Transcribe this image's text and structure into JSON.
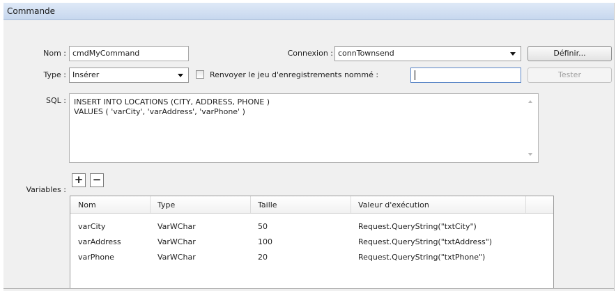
{
  "dialog": {
    "title": "Commande"
  },
  "form": {
    "name_label": "Nom :",
    "name_value": "cmdMyCommand",
    "connection_label": "Connexion :",
    "connection_value": "connTownsend",
    "define_button": "Définir...",
    "type_label": "Type :",
    "type_value": "Insérer",
    "return_recordset_label": "Renvoyer le jeu d'enregistrements nommé :",
    "return_recordset_checked": false,
    "return_recordset_value": "",
    "test_button": "Tester",
    "sql_label": "SQL :",
    "sql_line1": "INSERT INTO LOCATIONS (CITY, ADDRESS, PHONE )",
    "sql_line2": "VALUES ( 'varCity', 'varAddress', 'varPhone' )",
    "variables_label": "Variables :",
    "add_variable": "+",
    "remove_variable": "−"
  },
  "variables_table": {
    "columns": [
      "Nom",
      "Type",
      "Taille",
      "Valeur d'exécution"
    ],
    "rows": [
      [
        "varCity",
        "VarWChar",
        "50",
        "Request.QueryString(\"txtCity\")"
      ],
      [
        "varAddress",
        "VarWChar",
        "100",
        "Request.QueryString(\"txtAddress\")"
      ],
      [
        "varPhone",
        "VarWChar",
        "20",
        "Request.QueryString(\"txtPhone\")"
      ]
    ]
  }
}
